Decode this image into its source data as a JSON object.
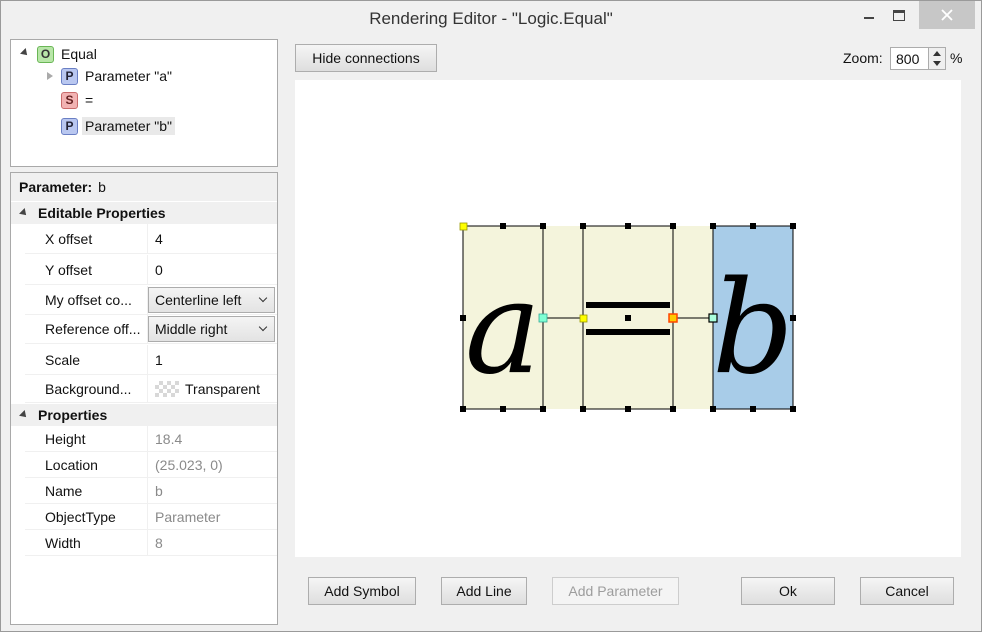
{
  "window": {
    "title": "Rendering Editor - \"Logic.Equal\""
  },
  "tree": {
    "root": {
      "badge": "O",
      "label": "Equal"
    },
    "children": [
      {
        "badge": "P",
        "label": "Parameter \"a\""
      },
      {
        "badge": "S",
        "label": "="
      },
      {
        "badge": "P",
        "label": "Parameter \"b\""
      }
    ]
  },
  "propgrid": {
    "header_label": "Parameter:",
    "header_value": "b",
    "editable_title": "Editable Properties",
    "editable": [
      {
        "name": "X offset",
        "value": "4"
      },
      {
        "name": "Y offset",
        "value": "0"
      },
      {
        "name": "My offset co...",
        "value": "Centerline left"
      },
      {
        "name": "Reference off...",
        "value": "Middle right"
      },
      {
        "name": "Scale",
        "value": "1"
      },
      {
        "name": "Background...",
        "value": "Transparent"
      }
    ],
    "props_title": "Properties",
    "props": [
      {
        "name": "Height",
        "value": "18.4"
      },
      {
        "name": "Location",
        "value": "(25.023, 0)"
      },
      {
        "name": "Name",
        "value": "b"
      },
      {
        "name": "ObjectType",
        "value": "Parameter"
      },
      {
        "name": "Width",
        "value": "8"
      }
    ]
  },
  "toolbar": {
    "hide_connections": "Hide connections",
    "zoom_label": "Zoom:",
    "zoom_value": "800",
    "zoom_unit": "%"
  },
  "canvas": {
    "glyph_a": "a",
    "glyph_b": "b",
    "colors": {
      "cell": "#f4f4dc",
      "selected": "#a8cce8",
      "handle": "#000000",
      "anchor_yellow": "#ffff00",
      "anchor_cyan": "#7fffd4",
      "anchor_orange": "#ff4500"
    }
  },
  "buttons": {
    "add_symbol": "Add Symbol",
    "add_line": "Add Line",
    "add_parameter": "Add Parameter",
    "ok": "Ok",
    "cancel": "Cancel"
  }
}
